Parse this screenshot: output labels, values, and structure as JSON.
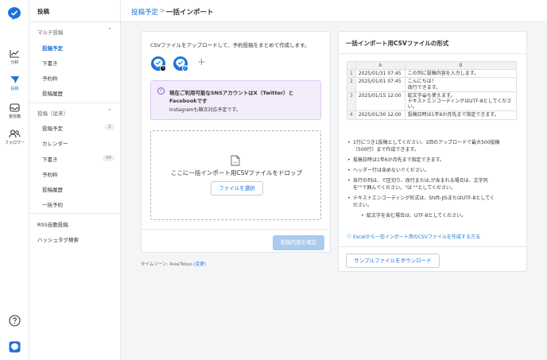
{
  "rail": {
    "items": [
      {
        "label": "分析",
        "icon": "chart-line-icon"
      },
      {
        "label": "投稿",
        "icon": "paper-plane-icon"
      },
      {
        "label": "受信箱",
        "icon": "inbox-icon"
      },
      {
        "label": "フォロワー",
        "icon": "users-icon"
      }
    ],
    "help_icon": "help-circle-icon",
    "bottom_logo": "app-logo-icon",
    "accent": "#1d74d6"
  },
  "sidebar": {
    "title": "投稿",
    "multi": {
      "group": "マルチ投稿",
      "items": [
        "投稿予定",
        "下書き",
        "予約枠",
        "投稿履歴"
      ]
    },
    "legacy": {
      "group": "投稿（従来）",
      "items": [
        {
          "label": "投稿予定",
          "count": "3"
        },
        {
          "label": "カレンダー",
          "count": ""
        },
        {
          "label": "下書き",
          "count": "49"
        },
        {
          "label": "予約枠",
          "count": ""
        },
        {
          "label": "投稿履歴",
          "count": ""
        },
        {
          "label": "一括予約",
          "count": ""
        }
      ]
    },
    "rss": "RSS自動投稿",
    "hashtag": "ハッシュタグ検索"
  },
  "breadcrumb": {
    "parent": "投稿予定",
    "sep": ">",
    "current": "一括インポート"
  },
  "upload": {
    "intro": "CSVファイルをアップロードして、予約投稿をまとめて作成します。",
    "notice_bold_1": "現在ご利用可能なSNSアカウントはX（Twitter）と",
    "notice_bold_2": "Facebookです",
    "notice_note": "Instagramも順次対応予定です。",
    "drop_text": "ここに一括インポート用CSVファイルをドロップ",
    "file_icon_label": "CSV",
    "select_button": "ファイルを選択",
    "confirm_button": "投稿内容を確認",
    "timezone_label": "タイムゾーン: Asia/Tokyo",
    "timezone_change": "(変更)"
  },
  "format": {
    "title": "一括インポート用CSVファイルの形式",
    "columns": [
      "",
      "A",
      "B"
    ],
    "rows": [
      {
        "n": "1",
        "a": "2025/01/31 07:45",
        "b": [
          "この列に投稿内容を入力します。"
        ]
      },
      {
        "n": "2",
        "a": "2025/01/01 07:45",
        "b": [
          "こんにちは！",
          "改行できます。"
        ]
      },
      {
        "n": "3",
        "a": "2025/01/15 12:00",
        "b": [
          "絵文字😀も使えます。",
          "テキストエンコーディングはUTF-8としてくださ",
          "い。"
        ]
      },
      {
        "n": "4",
        "a": "2025/01/30 12:00",
        "b": [
          "投稿日時は1年6か月先まで指定できます。"
        ]
      }
    ],
    "rules": [
      "1行につき1投稿としてください。1回のアップロードで最大500投稿",
      "（500行）まで作成できます。",
      "投稿日時は1年6か月先まで指定できます。",
      "ヘッダー行は含めないでください。",
      "各行の列は、で区切り、改行または,が含まれる場合は、文字列",
      "を\"\"で囲んでください。\"は \"\"としてください。",
      "テキストエンコーディング形式は、Shift-JISまたはUTF-8としてく",
      "ださい。",
      "絵文字を含む場合は、UTF-8としてください。"
    ],
    "help_link": "Excelから一括インポート用のCSVファイルを作成する方法",
    "sample_button": "サンプルファイルをダウンロード"
  }
}
